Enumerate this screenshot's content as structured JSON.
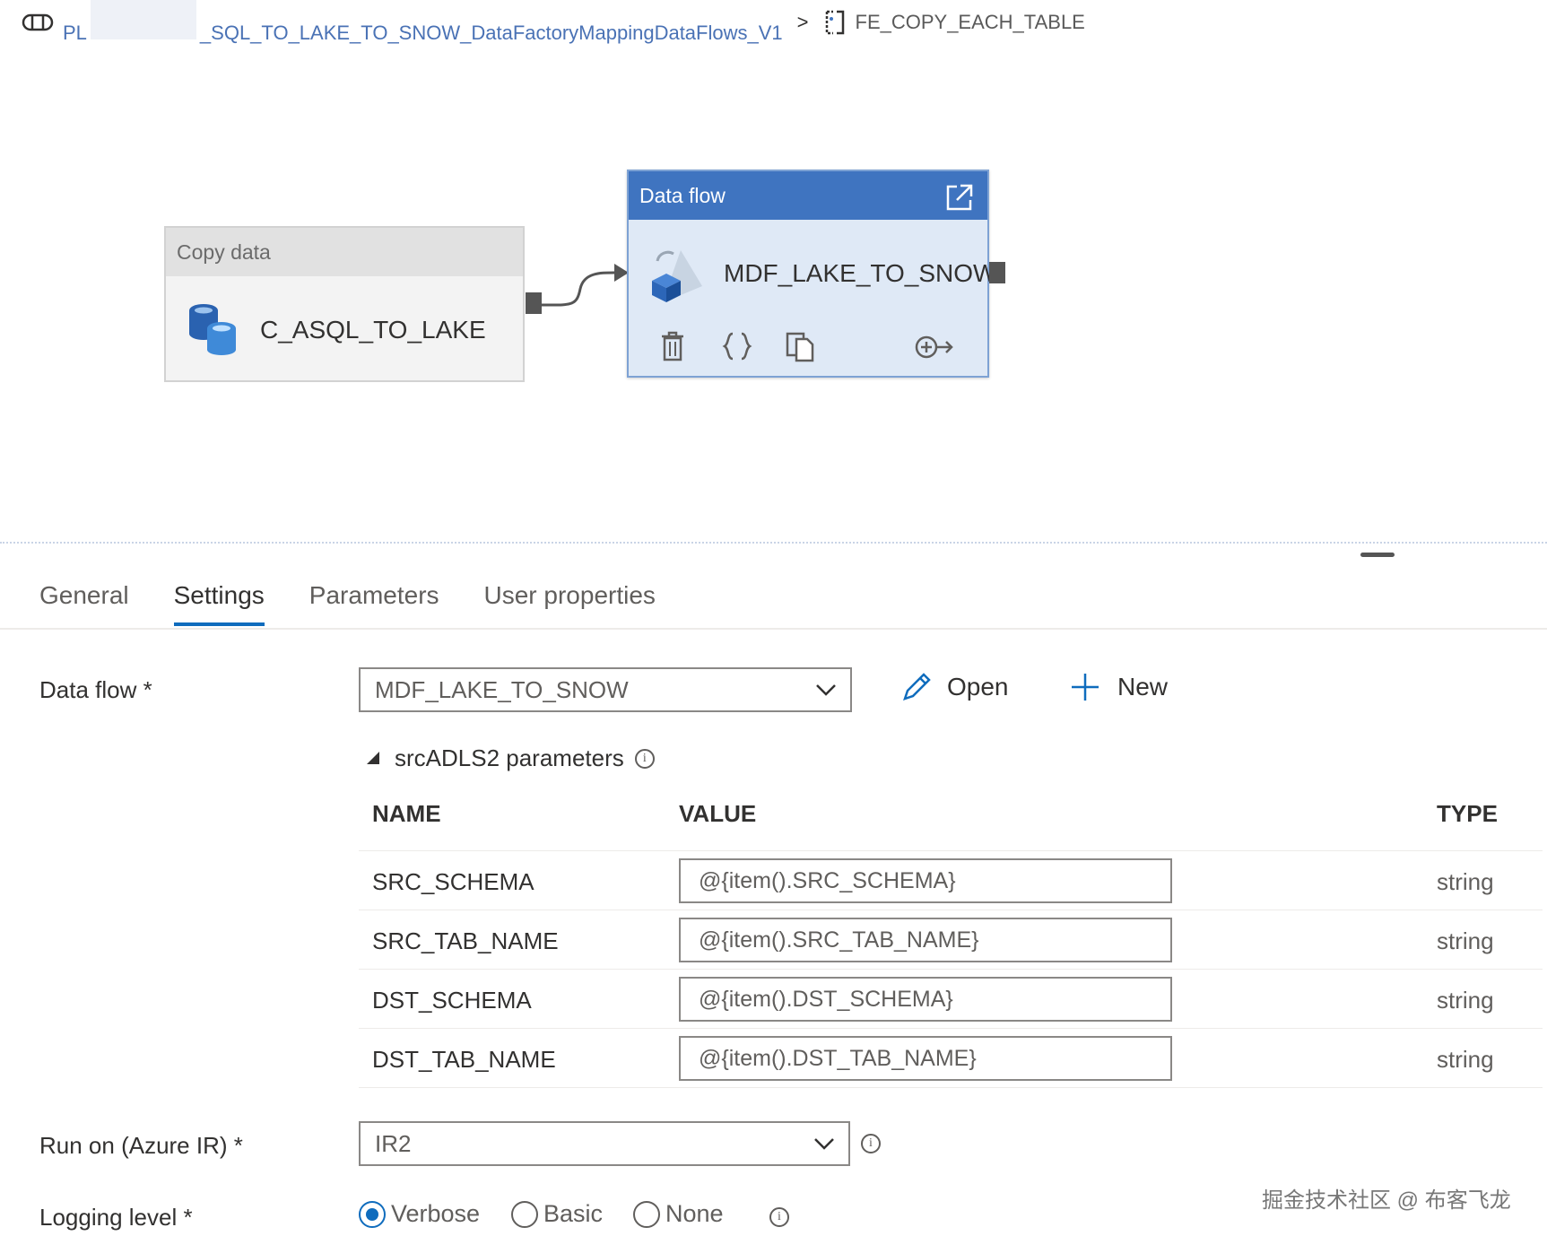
{
  "breadcrumb": {
    "pipeline_prefix": "PL",
    "pipeline_suffix": "_SQL_TO_LAKE_TO_SNOW_DataFactoryMappingDataFlows_V1",
    "separator": ">",
    "current": "FE_COPY_EACH_TABLE"
  },
  "canvas": {
    "copy_activity": {
      "type_label": "Copy data",
      "name": "C_ASQL_TO_LAKE"
    },
    "dataflow_activity": {
      "type_label": "Data flow",
      "name": "MDF_LAKE_TO_SNOW"
    }
  },
  "tabs": [
    {
      "label": "General"
    },
    {
      "label": "Settings"
    },
    {
      "label": "Parameters"
    },
    {
      "label": "User properties"
    }
  ],
  "active_tab": "Settings",
  "settings": {
    "dataflow_label": "Data flow *",
    "dataflow_value": "MDF_LAKE_TO_SNOW",
    "open_label": "Open",
    "new_label": "New",
    "params_section_label": "srcADLS2 parameters",
    "columns": {
      "name": "NAME",
      "value": "VALUE",
      "type": "TYPE"
    },
    "params": [
      {
        "name": "SRC_SCHEMA",
        "value": "@{item().SRC_SCHEMA}",
        "type": "string"
      },
      {
        "name": "SRC_TAB_NAME",
        "value": "@{item().SRC_TAB_NAME}",
        "type": "string"
      },
      {
        "name": "DST_SCHEMA",
        "value": "@{item().DST_SCHEMA}",
        "type": "string"
      },
      {
        "name": "DST_TAB_NAME",
        "value": "@{item().DST_TAB_NAME}",
        "type": "string"
      }
    ],
    "runon_label": "Run on (Azure IR) *",
    "runon_value": "IR2",
    "logging_label": "Logging level *",
    "logging_options": [
      {
        "label": "Verbose",
        "selected": true
      },
      {
        "label": "Basic",
        "selected": false
      },
      {
        "label": "None",
        "selected": false
      }
    ]
  },
  "watermark": "掘金技术社区 @ 布客飞龙",
  "colors": {
    "accent": "#0f6cbd",
    "dataflow_header": "#3f74c0",
    "link": "#4a72b5"
  }
}
